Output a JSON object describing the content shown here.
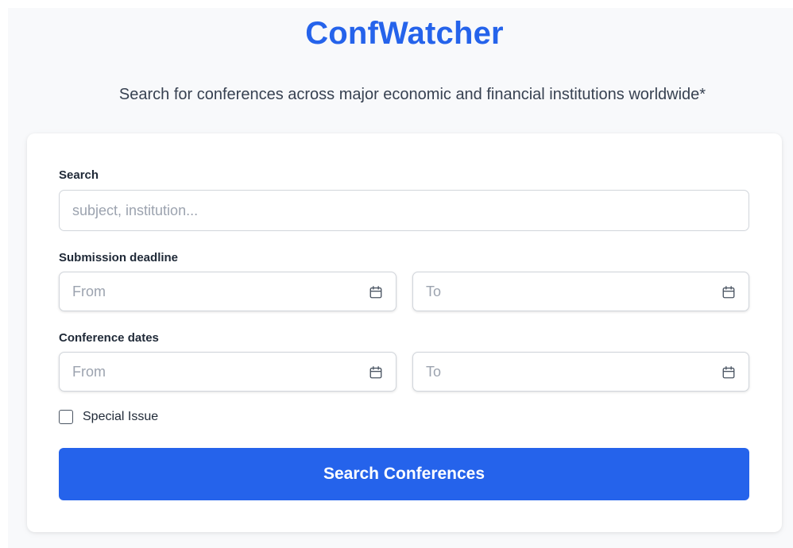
{
  "header": {
    "title": "ConfWatcher",
    "subtitle": "Search for conferences across major economic and financial institutions worldwide*"
  },
  "form": {
    "search": {
      "label": "Search",
      "placeholder": "subject, institution...",
      "value": ""
    },
    "submission_deadline": {
      "label": "Submission deadline",
      "from_placeholder": "From",
      "to_placeholder": "To"
    },
    "conference_dates": {
      "label": "Conference dates",
      "from_placeholder": "From",
      "to_placeholder": "To"
    },
    "special_issue": {
      "label": "Special Issue",
      "checked": false
    },
    "submit_label": "Search Conferences",
    "icons": {
      "date": "calendar-icon"
    }
  },
  "colors": {
    "accent": "#2563eb",
    "background": "#f8f9fb",
    "card": "#ffffff",
    "input_border": "#d1d5db",
    "placeholder": "#9ca3af"
  }
}
